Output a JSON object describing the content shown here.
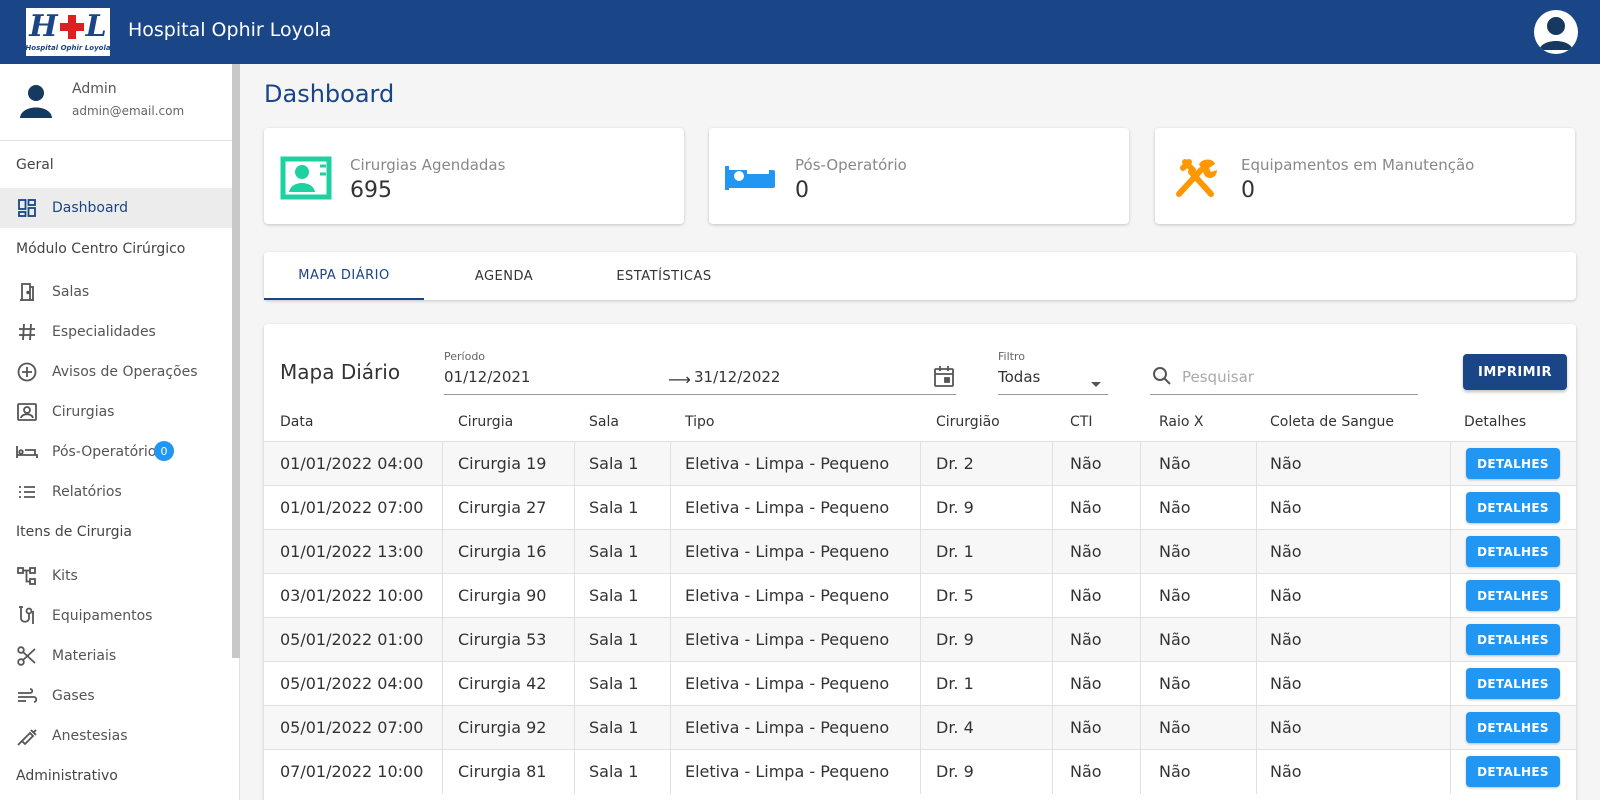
{
  "app": {
    "title": "Hospital Ophir Loyola",
    "logo_letters_left": "H",
    "logo_letters_right": "L",
    "logo_subtitle": "Hospital Ophir Loyola"
  },
  "user": {
    "name": "Admin",
    "email": "admin@email.com"
  },
  "sidebar": {
    "sections": [
      "Geral",
      "Módulo Centro Cirúrgico",
      "Itens de Cirurgia",
      "Administrativo"
    ],
    "items": [
      {
        "label": "Dashboard",
        "icon": "dashboard-icon",
        "active": true
      },
      {
        "label": "Salas",
        "icon": "door-icon"
      },
      {
        "label": "Especialidades",
        "icon": "hashtag-icon"
      },
      {
        "label": "Avisos de Operações",
        "icon": "add-circle-icon"
      },
      {
        "label": "Cirurgias",
        "icon": "person-frame-icon"
      },
      {
        "label": "Pós-Operatório",
        "icon": "bed-icon",
        "badge": "0"
      },
      {
        "label": "Relatórios",
        "icon": "list-icon"
      },
      {
        "label": "Kits",
        "icon": "tree-icon"
      },
      {
        "label": "Equipamentos",
        "icon": "equipment-icon"
      },
      {
        "label": "Materiais",
        "icon": "scissors-icon"
      },
      {
        "label": "Gases",
        "icon": "wind-icon"
      },
      {
        "label": "Anestesias",
        "icon": "syringe-icon"
      }
    ]
  },
  "page": {
    "title": "Dashboard"
  },
  "cards": [
    {
      "label": "Cirurgias Agendadas",
      "value": "695",
      "icon": "person-frame-icon",
      "color": "#1dd1a1"
    },
    {
      "label": "Pós-Operatório",
      "value": "0",
      "icon": "bed-icon",
      "color": "#2196f3"
    },
    {
      "label": "Equipamentos em Manutenção",
      "value": "0",
      "icon": "tools-icon",
      "color": "#ff9800"
    }
  ],
  "tabs": [
    {
      "label": "MAPA DIÁRIO",
      "active": true
    },
    {
      "label": "AGENDA"
    },
    {
      "label": "ESTATÍSTICAS"
    }
  ],
  "mapa": {
    "title": "Mapa Diário",
    "period_label": "Período",
    "period_start": "01/12/2021",
    "period_end": "31/12/2022",
    "filter_label": "Filtro",
    "filter_value": "Todas",
    "search_placeholder": "Pesquisar",
    "print_label": "IMPRIMIR",
    "details_label": "DETALHES",
    "columns": [
      "Data",
      "Cirurgia",
      "Sala",
      "Tipo",
      "Cirurgião",
      "CTI",
      "Raio X",
      "Coleta de Sangue",
      "Detalhes"
    ],
    "rows": [
      [
        "01/01/2022 04:00",
        "Cirurgia 19",
        "Sala 1",
        "Eletiva - Limpa - Pequeno",
        "Dr. 2",
        "Não",
        "Não",
        "Não"
      ],
      [
        "01/01/2022 07:00",
        "Cirurgia 27",
        "Sala 1",
        "Eletiva - Limpa - Pequeno",
        "Dr. 9",
        "Não",
        "Não",
        "Não"
      ],
      [
        "01/01/2022 13:00",
        "Cirurgia 16",
        "Sala 1",
        "Eletiva - Limpa - Pequeno",
        "Dr. 1",
        "Não",
        "Não",
        "Não"
      ],
      [
        "03/01/2022 10:00",
        "Cirurgia 90",
        "Sala 1",
        "Eletiva - Limpa - Pequeno",
        "Dr. 5",
        "Não",
        "Não",
        "Não"
      ],
      [
        "05/01/2022 01:00",
        "Cirurgia 53",
        "Sala 1",
        "Eletiva - Limpa - Pequeno",
        "Dr. 9",
        "Não",
        "Não",
        "Não"
      ],
      [
        "05/01/2022 04:00",
        "Cirurgia 42",
        "Sala 1",
        "Eletiva - Limpa - Pequeno",
        "Dr. 1",
        "Não",
        "Não",
        "Não"
      ],
      [
        "05/01/2022 07:00",
        "Cirurgia 92",
        "Sala 1",
        "Eletiva - Limpa - Pequeno",
        "Dr. 4",
        "Não",
        "Não",
        "Não"
      ],
      [
        "07/01/2022 10:00",
        "Cirurgia 81",
        "Sala 1",
        "Eletiva - Limpa - Pequeno",
        "Dr. 9",
        "Não",
        "Não",
        "Não"
      ]
    ]
  }
}
